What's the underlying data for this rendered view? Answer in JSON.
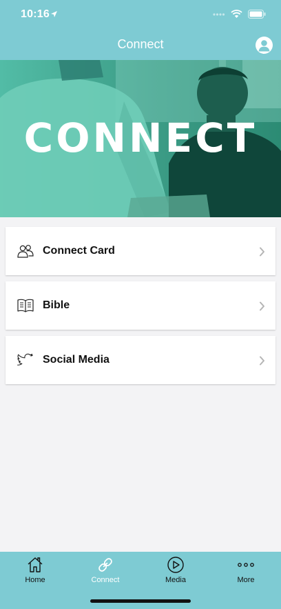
{
  "status_bar": {
    "time": "10:16"
  },
  "nav": {
    "title": "Connect",
    "profile_icon": "person-icon"
  },
  "hero": {
    "text": "CONNECT"
  },
  "menu": {
    "items": [
      {
        "label": "Connect Card",
        "icon": "people-icon"
      },
      {
        "label": "Bible",
        "icon": "book-icon"
      },
      {
        "label": "Social Media",
        "icon": "twitter-bird-icon"
      }
    ]
  },
  "tabs": [
    {
      "label": "Home",
      "icon": "home-icon",
      "active": false
    },
    {
      "label": "Connect",
      "icon": "link-icon",
      "active": true
    },
    {
      "label": "Media",
      "icon": "play-icon",
      "active": false
    },
    {
      "label": "More",
      "icon": "more-dots-icon",
      "active": false
    }
  ],
  "colors": {
    "accent": "#7ecbd3",
    "background": "#f3f3f5",
    "active_tab_label": "#ffffff"
  }
}
